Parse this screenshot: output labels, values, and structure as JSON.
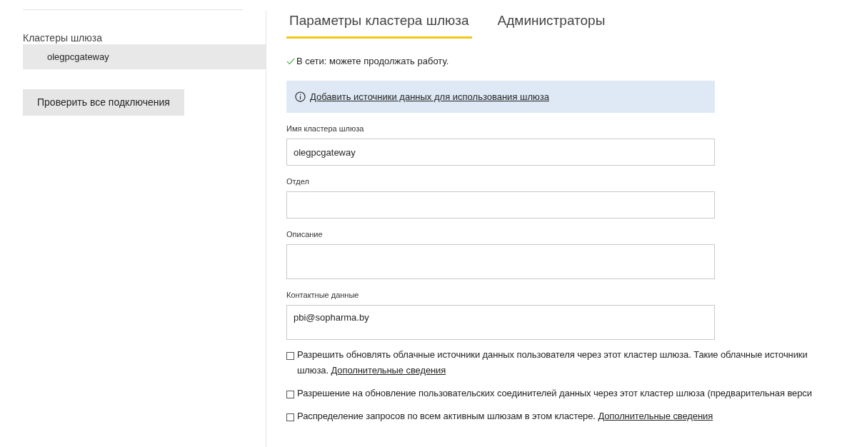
{
  "sidebar": {
    "section_title": "Кластеры шлюза",
    "clusters": [
      {
        "name": "olegpcgateway",
        "selected": true
      }
    ],
    "test_button": "Проверить все подключения"
  },
  "tabs": [
    {
      "label": "Параметры кластера шлюза",
      "selected": true
    },
    {
      "label": "Администраторы",
      "selected": false
    }
  ],
  "status": {
    "online": true,
    "text": "В сети: можете продолжать работу."
  },
  "info_banner": {
    "link": "Добавить источники данных для использования шлюза"
  },
  "fields": [
    {
      "label": "Имя кластера шлюза",
      "value": "olegpcgateway",
      "multiline": false
    },
    {
      "label": "Отдел",
      "multiline": false
    },
    {
      "label": "Описание",
      "multiline": true
    },
    {
      "label": "Контактные данные",
      "value": "pbi@sopharma.by",
      "multiline": true
    }
  ],
  "options": [
    {
      "text": "Разрешить обновлять облачные источники данных пользователя через этот кластер шлюза. Такие облачные источники",
      "continuation": "шлюза.",
      "link": "Дополнительные сведения",
      "checked": false
    },
    {
      "text": "Разрешение на обновление пользовательских соединителей данных через этот кластер шлюза (предварительная верси",
      "checked": false
    },
    {
      "text": "Распределение запросов по всем активным шлюзам в этом кластере.",
      "link": "Дополнительные сведения",
      "checked": false
    }
  ]
}
